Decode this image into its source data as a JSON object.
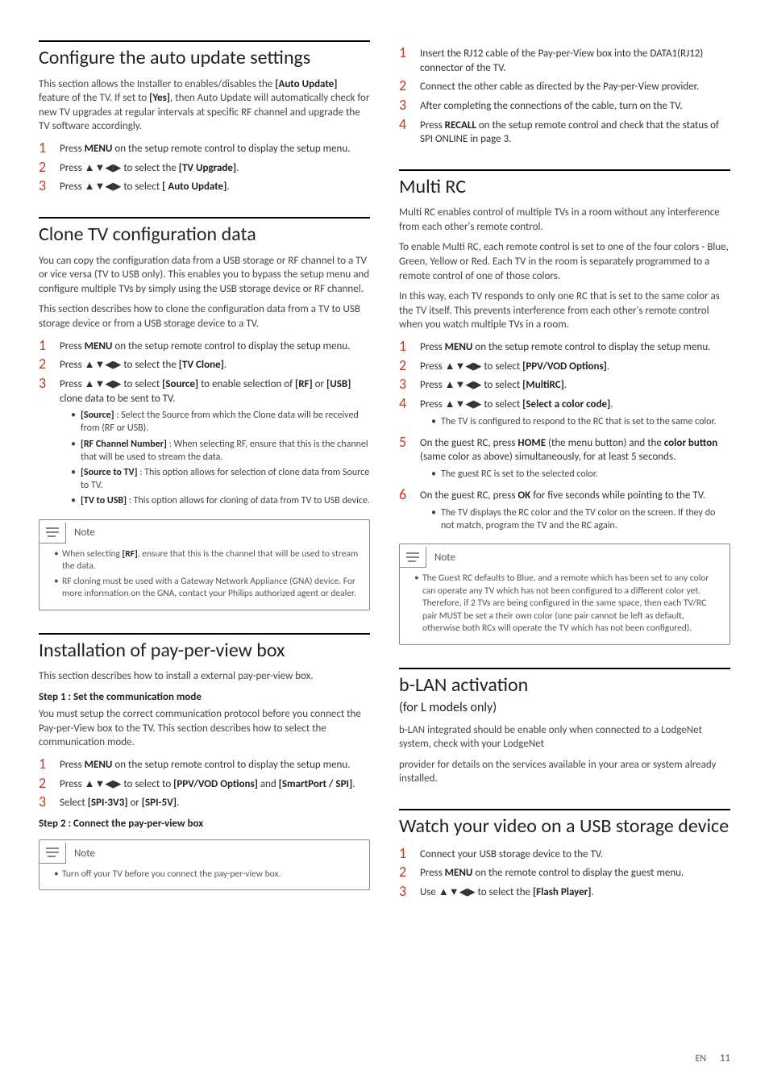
{
  "arrows": "▲▼◀▶",
  "left": {
    "s1": {
      "title": "Configure the auto update settings",
      "intro": "This section allows the Installer to enables/disables the [Auto Update] feature of the TV. If set to [Yes], then Auto Update will automatically check for new TV upgrades at regular intervals at specific RF channel and upgrade the TV software accordingly.",
      "steps": [
        "Press MENU on the setup remote control to display the setup menu.",
        "Press ▲▼◀▶ to select the [TV Upgrade].",
        "Press ▲▼◀▶ to select [ Auto Update]."
      ]
    },
    "s2": {
      "title": "Clone TV configuration data",
      "p1": "You can copy the configuration data from a USB storage or RF channel to a TV or vice versa (TV to USB only). This enables you to bypass the setup menu and configure multiple TVs by simply using the USB storage device or RF channel.",
      "p2": "This section describes how to clone the configuration data from a TV to USB storage device or from a USB storage device to a TV.",
      "steps": [
        "Press MENU on the setup remote control to display the setup menu.",
        "Press ▲▼◀▶ to select the [TV Clone].",
        "Press ▲▼◀▶ to select [Source] to enable selection of [RF] or [USB] clone data to be sent to TV."
      ],
      "bullets": [
        "[Source] : Select the Source from which the Clone data will be received from (RF or USB).",
        "[RF Channel Number] : When selecting RF, ensure that this is the channel that will be used to stream the data.",
        "[Source to TV] : This option allows for selection of clone data from Source to TV.",
        "[TV to USB] : This option allows for cloning of data from TV to USB device."
      ],
      "note_label": "Note",
      "notes": [
        "When selecting [RF], ensure that this is the channel that will be used to stream the data.",
        "RF cloning must be used with a Gateway Network Appliance (GNA) device. For more information on the GNA, contact your Philips authorized agent or dealer."
      ]
    },
    "s3": {
      "title": "Installation of pay-per-view box",
      "intro": "This section describes how to install a external pay-per-view box.",
      "step1_head": "Step 1 : Set the communication mode",
      "step1_p": "You must setup the correct communication protocol before you connect the Pay-per-View box to the TV. This section describes how to select the communication mode.",
      "step1_list": [
        "Press MENU on the setup remote control to display the setup menu.",
        "Press ▲▼◀▶ to select to [PPV/VOD Options] and [SmartPort / SPI].",
        "Select [SPI-3V3] or [SPI-5V]."
      ],
      "step2_head": "Step 2 : Connect the pay-per-view box",
      "note_label": "Note",
      "notes": [
        "Turn off your TV before you connect the pay-per-view box."
      ]
    }
  },
  "right": {
    "s0": {
      "steps": [
        "Insert the RJ12 cable of the Pay-per-View box into the DATA1(RJ12) connector of the TV.",
        "Connect the other cable as directed by the Pay-per-View provider.",
        "After completing the connections of the cable, turn on the TV.",
        "Press RECALL on the setup remote control and check that the status of SPI ONLINE in page 3."
      ]
    },
    "s1": {
      "title": "Multi RC",
      "p1": "Multi RC enables control of multiple TVs in a room without any interference from each other's remote control.",
      "p2": "To enable Multi RC, each remote control is set to one of the four colors - Blue, Green, Yellow or Red. Each TV in the room is separately programmed to a remote control of one of those colors.",
      "p3": "In this way, each TV responds to only one RC that is set to the same color as the TV itself. This prevents interference from each other's remote control when you watch multiple TVs in a room.",
      "steps": [
        {
          "t": "Press MENU on the setup remote control to display the setup menu."
        },
        {
          "t": "Press ▲▼◀▶ to select [PPV/VOD Options]."
        },
        {
          "t": "Press ▲▼◀▶ to select [MultiRC]."
        },
        {
          "t": "Press ▲▼◀▶ to select [Select a color code].",
          "sub": [
            "The TV is configured to respond to the RC that is set to the same color."
          ]
        },
        {
          "t": "On the guest RC, press HOME (the menu button) and the color button (same color as above) simultaneously, for at least 5 seconds.",
          "sub": [
            "The guest RC is set to the selected color."
          ]
        },
        {
          "t": "On the guest RC, press OK for five seconds while pointing to the TV.",
          "sub": [
            "The TV displays the RC color and the TV color on the screen. If they do not match, program the TV and the RC again."
          ]
        }
      ],
      "note_label": "Note",
      "notes": [
        "The Guest RC defaults to Blue, and a remote which has been set to any color can operate any TV which has not been configured to a different color yet. Therefore, if 2 TVs are being configured in the same space, then each TV/RC pair MUST be set a their own color (one pair cannot be left as default, otherwise both RCs will operate the TV which has not been configured)."
      ]
    },
    "s2": {
      "title": "b-LAN activation",
      "subtitle": "(for L models only)",
      "p1": "b-LAN integrated should be enable only when connected to a LodgeNet system, check with your LodgeNet",
      "p2": "provider for details on the services available in your area or system already installed."
    },
    "s3": {
      "title": "Watch your video on a USB storage device",
      "steps": [
        "Connect your USB storage device to the TV.",
        "Press MENU on the remote control to display the guest menu.",
        "Use ▲▼◀▶ to select the [Flash Player]."
      ]
    }
  },
  "footer": {
    "lang": "EN",
    "page": "11"
  }
}
